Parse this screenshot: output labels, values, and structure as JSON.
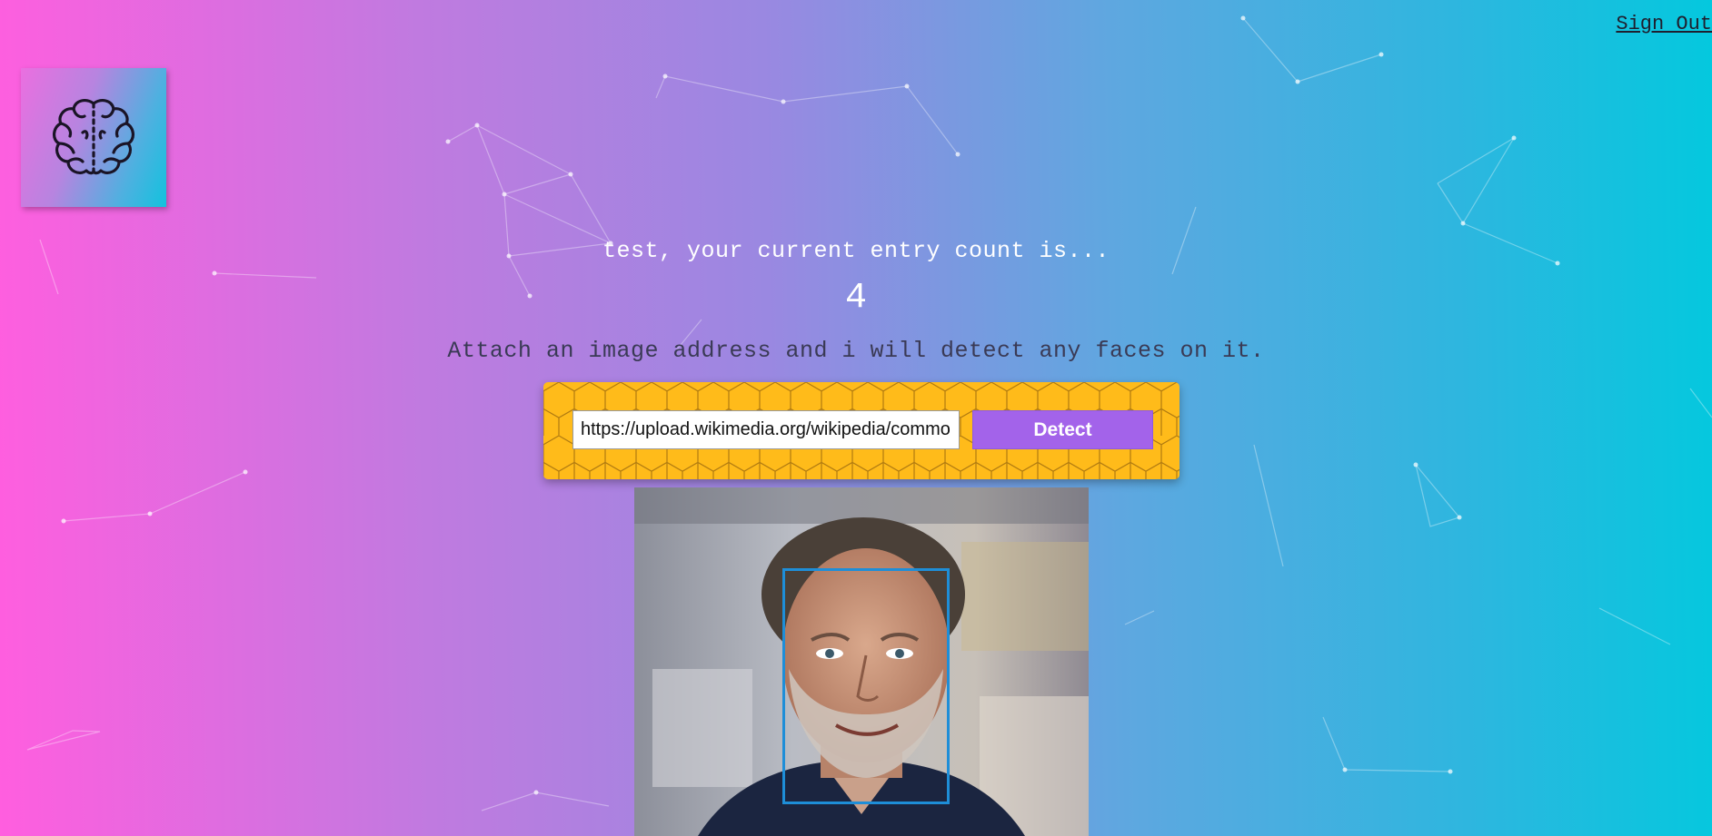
{
  "header": {
    "sign_out_label": "Sign Out"
  },
  "logo": {
    "icon": "brain-icon"
  },
  "rank": {
    "greeting": "test, your current entry count is...",
    "count": "4"
  },
  "form": {
    "instructions": "Attach an image address and i will detect any faces on it.",
    "url_value": "https://upload.wikimedia.org/wikipedia/commons",
    "detect_label": "Detect"
  },
  "result": {
    "face_count": 1,
    "face_box_color": "#1e8ed8"
  },
  "colors": {
    "background_left": "#ff5edf",
    "background_right": "#04c8de",
    "panel": "#ffbb1a",
    "detect_button": "#a363ea"
  }
}
